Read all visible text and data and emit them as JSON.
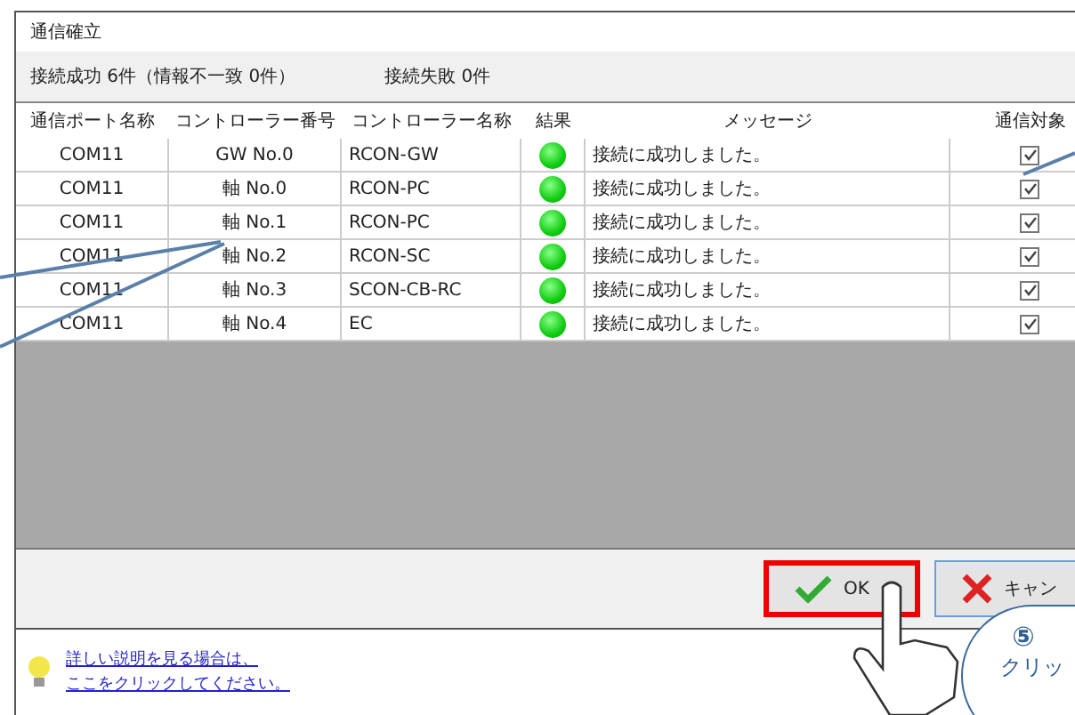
{
  "window": {
    "title": "通信確立"
  },
  "summary": {
    "success": "接続成功 6件（情報不一致 0件）",
    "failure": "接続失敗 0件"
  },
  "table": {
    "columns": [
      "通信ポート名称",
      "コントローラー番号",
      "コントローラー名称",
      "結果",
      "メッセージ",
      "通信対象"
    ],
    "rows": [
      {
        "port": "COM11",
        "number": "GW No.0",
        "name": "RCON-GW",
        "success": true,
        "message": "接続に成功しました。",
        "checked": true
      },
      {
        "port": "COM11",
        "number": "軸 No.0",
        "name": "RCON-PC",
        "success": true,
        "message": "接続に成功しました。",
        "checked": true
      },
      {
        "port": "COM11",
        "number": "軸 No.1",
        "name": "RCON-PC",
        "success": true,
        "message": "接続に成功しました。",
        "checked": true
      },
      {
        "port": "COM11",
        "number": "軸 No.2",
        "name": "RCON-SC",
        "success": true,
        "message": "接続に成功しました。",
        "checked": true
      },
      {
        "port": "COM11",
        "number": "軸 No.3",
        "name": "SCON-CB-RC",
        "success": true,
        "message": "接続に成功しました。",
        "checked": true
      },
      {
        "port": "COM11",
        "number": "軸 No.4",
        "name": "EC",
        "success": true,
        "message": "接続に成功しました。",
        "checked": true
      }
    ]
  },
  "buttons": [
    {
      "kind": "ok",
      "label": "OK",
      "highlighted": true
    },
    {
      "kind": "cancel",
      "label": "キャン",
      "highlighted": false
    }
  ],
  "help_link": {
    "lines": [
      "詳しい説明を見る場合は、",
      "ここをクリックしてください。"
    ]
  },
  "callout": {
    "number": "⑤",
    "text": "クリッ"
  }
}
